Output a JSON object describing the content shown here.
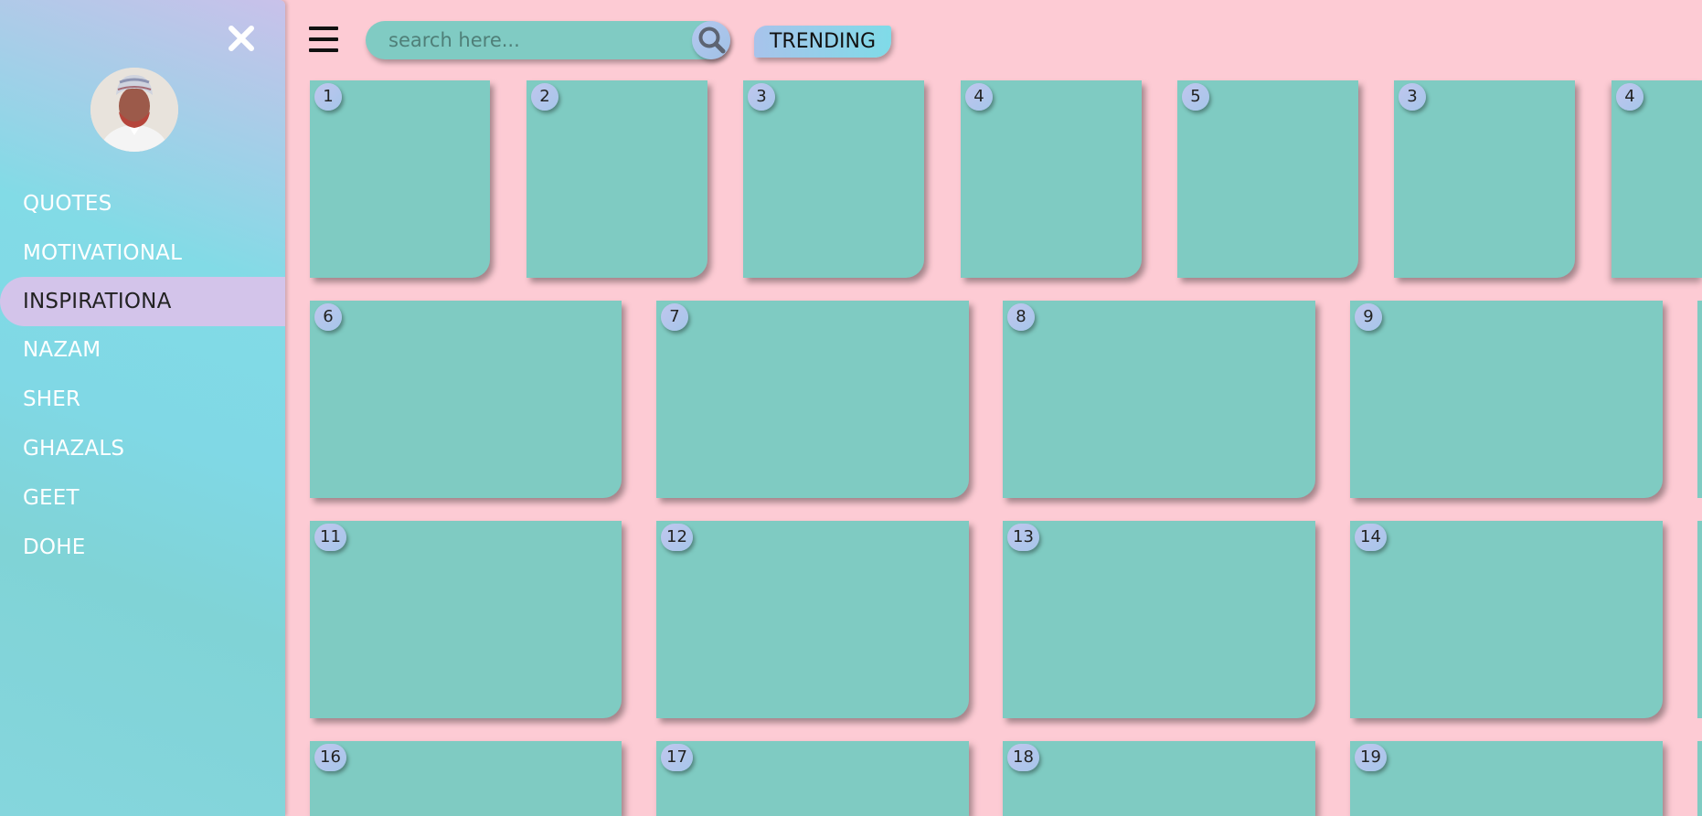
{
  "sidebar": {
    "close_icon": "close-icon",
    "avatar_icon": "user-avatar",
    "items": [
      {
        "label": "QUOTES",
        "active": false
      },
      {
        "label": "MOTIVATIONAL",
        "active": false
      },
      {
        "label": "INSPIRATIONA",
        "active": true
      },
      {
        "label": "NAZAM",
        "active": false
      },
      {
        "label": "SHER",
        "active": false
      },
      {
        "label": "GHAZALS",
        "active": false
      },
      {
        "label": "GEET",
        "active": false
      },
      {
        "label": "DOHE",
        "active": false
      }
    ]
  },
  "header": {
    "menu_icon": "hamburger-menu-icon",
    "search": {
      "placeholder": "search here...",
      "value": "",
      "icon": "search-icon"
    },
    "trending_label": "TRENDING"
  },
  "grid": {
    "row1": [
      "1",
      "2",
      "3",
      "4",
      "5",
      "3",
      "4"
    ],
    "row2": [
      "6",
      "7",
      "8",
      "9"
    ],
    "row3": [
      "11",
      "12",
      "13",
      "14"
    ],
    "row4": [
      "16",
      "17",
      "18",
      "19"
    ]
  },
  "colors": {
    "background": "#fdcbd4",
    "card": "#7fcbc2",
    "active_nav": "#d3c4ea",
    "sidebar": "#80d8e5"
  }
}
